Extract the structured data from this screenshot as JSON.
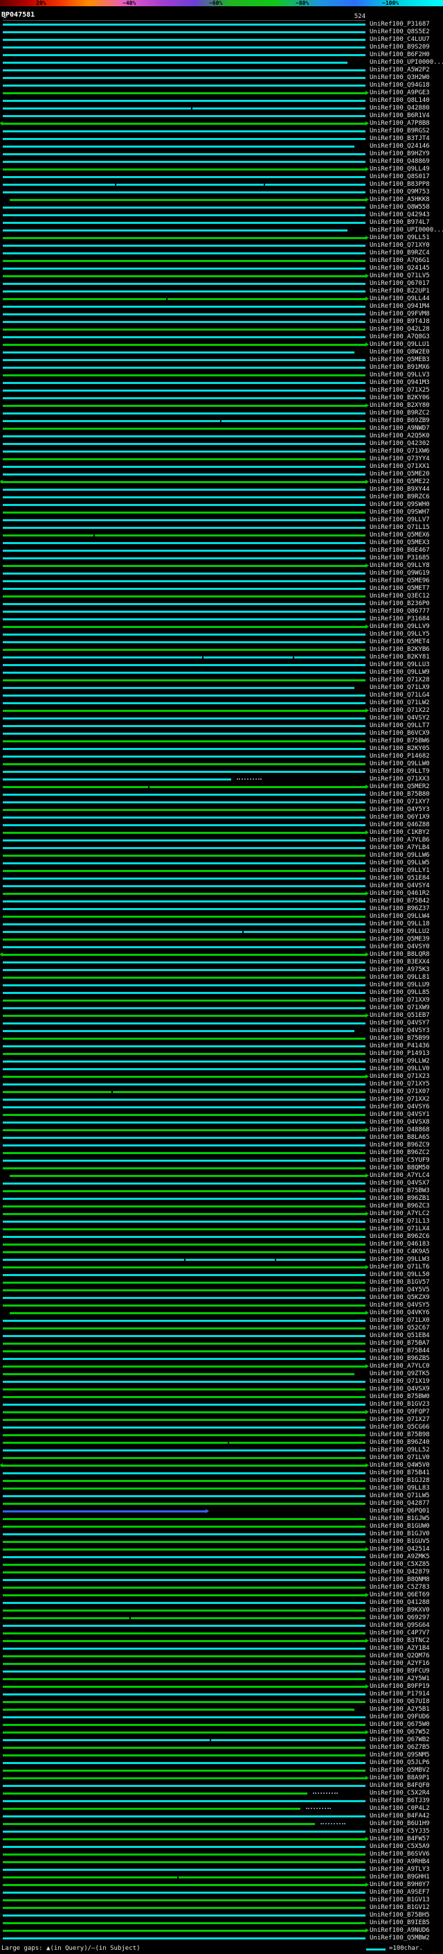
{
  "header": {
    "query_id": "BP047581"
  },
  "ruler": {
    "start": "1",
    "end": "524"
  },
  "legend": {
    "gaps_text": "Large gaps: ▲(in Query)/—(in Subject)",
    "scale_text": "=100char."
  },
  "id_prefix": "UniRef100_",
  "colors": {
    "c": "#00dcdc",
    "g": "#00cc00",
    "b": "#3264ff"
  },
  "scale": {
    "labels": [
      "20%",
      "~40%",
      "~60%",
      "~80%",
      "~100%"
    ],
    "gradient": [
      "#600000 0%",
      "#b40000 6%",
      "#f23000 13%",
      "#ff8c00 20%",
      "#e85fc0 28%",
      "#a83fd0 36%",
      "#6a3fd8 44%",
      "#20b420 52%",
      "#10c818 62%",
      "#1e96dc 72%",
      "#2d6eff 80%",
      "#00c8dc 88%",
      "#00ffff 100%"
    ]
  },
  "chart_data": {
    "type": "bar",
    "orientation": "horizontal",
    "title": "BP047581",
    "x_range": [
      1,
      524
    ],
    "x_units": "query residues (1 px = 1 char)",
    "legend_position": "top",
    "identity_color_key": {
      "~20%": "#ff8c00",
      "~40%": "#a83fd0",
      "~60%": "#20b420",
      "~80%": "#2d6eff",
      "~100%": "#00ffff"
    },
    "rows": [
      {
        "id": "P31687",
        "c": "c"
      },
      {
        "id": "Q8S5E2",
        "c": "c"
      },
      {
        "id": "C4LUU7",
        "c": "c"
      },
      {
        "id": "B9S209",
        "c": "c"
      },
      {
        "id": "B6F2H0",
        "c": "c"
      },
      {
        "id": "UPI0000...",
        "c": "c",
        "w": 0.95
      },
      {
        "id": "A5W2P2",
        "c": "c"
      },
      {
        "id": "Q3H2W0",
        "c": "c"
      },
      {
        "id": "Q94G18",
        "c": "c"
      },
      {
        "id": "A9PGE3",
        "c": "g",
        "a": 1
      },
      {
        "id": "Q8L140",
        "c": "c"
      },
      {
        "id": "Q42880",
        "c": "c",
        "G": [
          0.52
        ]
      },
      {
        "id": "B6R1V4",
        "c": "c"
      },
      {
        "id": "A7P8B8",
        "c": "g",
        "a": 1,
        "la": 1
      },
      {
        "id": "B9RGS2",
        "c": "c"
      },
      {
        "id": "B3TJT4",
        "c": "c"
      },
      {
        "id": "Q24146",
        "c": "c",
        "w": 0.97
      },
      {
        "id": "B9HZY9",
        "c": "c"
      },
      {
        "id": "Q48869",
        "c": "c"
      },
      {
        "id": "Q9LL49",
        "c": "g",
        "a": 1
      },
      {
        "id": "Q8S017",
        "c": "c"
      },
      {
        "id": "B83PP8",
        "c": "c",
        "G": [
          0.31,
          0.72
        ]
      },
      {
        "id": "Q9M753",
        "c": "c"
      },
      {
        "id": "A5HKK8",
        "c": "g",
        "a": 1,
        "s": 0.02
      },
      {
        "id": "Q8W558",
        "c": "c"
      },
      {
        "id": "Q42943",
        "c": "c"
      },
      {
        "id": "B974L7",
        "c": "c"
      },
      {
        "id": "UPI0000...",
        "c": "c",
        "w": 0.95
      },
      {
        "id": "Q9LL51",
        "c": "g",
        "a": 1
      },
      {
        "id": "Q71XY0",
        "c": "c"
      },
      {
        "id": "B9RZC4",
        "c": "c"
      },
      {
        "id": "A7Q6G1",
        "c": "g"
      },
      {
        "id": "Q24145",
        "c": "c"
      },
      {
        "id": "Q71LV5",
        "c": "g",
        "a": 1
      },
      {
        "id": "Q67017",
        "c": "c"
      },
      {
        "id": "B22UP1",
        "c": "c"
      },
      {
        "id": "Q9LL44",
        "c": "g",
        "a": 1,
        "G": [
          0.45
        ]
      },
      {
        "id": "Q941M4",
        "c": "c"
      },
      {
        "id": "Q9FVM8",
        "c": "c"
      },
      {
        "id": "B9T4J8",
        "c": "c"
      },
      {
        "id": "Q42L28",
        "c": "g"
      },
      {
        "id": "A7Q8G3",
        "c": "c"
      },
      {
        "id": "Q9LLU1",
        "c": "g",
        "a": 1
      },
      {
        "id": "Q8W2E0",
        "c": "c",
        "w": 0.97
      },
      {
        "id": "Q5MEB3",
        "c": "c"
      },
      {
        "id": "B91MX6",
        "c": "c"
      },
      {
        "id": "Q9LLV3",
        "c": "g"
      },
      {
        "id": "Q941M3",
        "c": "c"
      },
      {
        "id": "Q71X25",
        "c": "c"
      },
      {
        "id": "B2KY06",
        "c": "c"
      },
      {
        "id": "B2XY80",
        "c": "g",
        "a": 1
      },
      {
        "id": "B9RZC2",
        "c": "c"
      },
      {
        "id": "B69ZB9",
        "c": "c",
        "G": [
          0.6
        ]
      },
      {
        "id": "A9NWD7",
        "c": "g"
      },
      {
        "id": "A2Q5K0",
        "c": "c"
      },
      {
        "id": "Q42302",
        "c": "c"
      },
      {
        "id": "Q71XW6",
        "c": "c"
      },
      {
        "id": "Q73YY4",
        "c": "g"
      },
      {
        "id": "Q71XX1",
        "c": "c"
      },
      {
        "id": "Q5ME20",
        "c": "c"
      },
      {
        "id": "Q5ME22",
        "c": "g",
        "a": 1,
        "la": 1
      },
      {
        "id": "B9XY44",
        "c": "c"
      },
      {
        "id": "B9RZC6",
        "c": "c"
      },
      {
        "id": "Q9SWH0",
        "c": "c"
      },
      {
        "id": "Q9SWH7",
        "c": "g"
      },
      {
        "id": "Q9LLV7",
        "c": "c"
      },
      {
        "id": "Q71L15",
        "c": "c"
      },
      {
        "id": "Q5MEX6",
        "c": "g",
        "G": [
          0.25
        ]
      },
      {
        "id": "Q5MEX3",
        "c": "c"
      },
      {
        "id": "B6E467",
        "c": "c"
      },
      {
        "id": "P31685",
        "c": "c"
      },
      {
        "id": "Q9LLY8",
        "c": "g",
        "a": 1
      },
      {
        "id": "Q9WG19",
        "c": "c"
      },
      {
        "id": "Q5ME96",
        "c": "c"
      },
      {
        "id": "Q5MET7",
        "c": "c"
      },
      {
        "id": "Q3EC12",
        "c": "g"
      },
      {
        "id": "B236P0",
        "c": "c"
      },
      {
        "id": "Q86777",
        "c": "c"
      },
      {
        "id": "P31684",
        "c": "c"
      },
      {
        "id": "Q9LLV9",
        "c": "g",
        "a": 1
      },
      {
        "id": "Q9LLY5",
        "c": "c"
      },
      {
        "id": "Q5MET4",
        "c": "c"
      },
      {
        "id": "B2KYB6",
        "c": "g"
      },
      {
        "id": "B2KY81",
        "c": "c",
        "G": [
          0.55,
          0.8
        ]
      },
      {
        "id": "Q9LLU3",
        "c": "c"
      },
      {
        "id": "Q9LLW9",
        "c": "c"
      },
      {
        "id": "Q71X28",
        "c": "g"
      },
      {
        "id": "Q71LX9",
        "c": "c",
        "w": 0.97
      },
      {
        "id": "Q71LG4",
        "c": "c"
      },
      {
        "id": "Q71LW2",
        "c": "c"
      },
      {
        "id": "Q71X22",
        "c": "g",
        "a": 1
      },
      {
        "id": "Q4VSY2",
        "c": "c"
      },
      {
        "id": "Q9LLT7",
        "c": "c"
      },
      {
        "id": "B6VCX9",
        "c": "c"
      },
      {
        "id": "B75BW6",
        "c": "g"
      },
      {
        "id": "B2KY05",
        "c": "c"
      },
      {
        "id": "P14682",
        "c": "c"
      },
      {
        "id": "Q9LLW0",
        "c": "g"
      },
      {
        "id": "Q9LLT9",
        "c": "c"
      },
      {
        "id": "Q71XX3",
        "c": "c",
        "w": 0.63,
        "d": 1
      },
      {
        "id": "Q5MER2",
        "c": "g",
        "a": 1,
        "G": [
          0.4
        ]
      },
      {
        "id": "B75B80",
        "c": "c"
      },
      {
        "id": "Q71XY7",
        "c": "c"
      },
      {
        "id": "Q4Y5Y3",
        "c": "g"
      },
      {
        "id": "Q6Y1X9",
        "c": "c"
      },
      {
        "id": "Q46Z88",
        "c": "c"
      },
      {
        "id": "C1KBY2",
        "c": "g",
        "a": 1
      },
      {
        "id": "A7YLB6",
        "c": "c"
      },
      {
        "id": "A7YLB4",
        "c": "c"
      },
      {
        "id": "Q9LLW6",
        "c": "g"
      },
      {
        "id": "Q9LLW5",
        "c": "c"
      },
      {
        "id": "Q9LLY1",
        "c": "g"
      },
      {
        "id": "Q51E84",
        "c": "c"
      },
      {
        "id": "Q4VSY4",
        "c": "c"
      },
      {
        "id": "Q461R2",
        "c": "g",
        "a": 1
      },
      {
        "id": "B75B42",
        "c": "c"
      },
      {
        "id": "B96Z37",
        "c": "c"
      },
      {
        "id": "Q9LLW4",
        "c": "g"
      },
      {
        "id": "Q9LL18",
        "c": "c"
      },
      {
        "id": "Q9LLU2",
        "c": "c",
        "G": [
          0.66
        ]
      },
      {
        "id": "Q5ME39",
        "c": "g"
      },
      {
        "id": "Q4VSY0",
        "c": "c"
      },
      {
        "id": "B8LQR8",
        "c": "g",
        "a": 1,
        "la": 1
      },
      {
        "id": "B3EXX4",
        "c": "c"
      },
      {
        "id": "A975K3",
        "c": "c"
      },
      {
        "id": "Q9LL81",
        "c": "g"
      },
      {
        "id": "Q9LLU9",
        "c": "c"
      },
      {
        "id": "Q9LL85",
        "c": "c"
      },
      {
        "id": "Q71XX9",
        "c": "g"
      },
      {
        "id": "Q71XW9",
        "c": "c"
      },
      {
        "id": "Q51EB7",
        "c": "g",
        "a": 1
      },
      {
        "id": "Q4VSY7",
        "c": "c"
      },
      {
        "id": "Q4VSY3",
        "c": "c",
        "w": 0.97
      },
      {
        "id": "B75B99",
        "c": "g"
      },
      {
        "id": "P41436",
        "c": "c"
      },
      {
        "id": "P14913",
        "c": "g"
      },
      {
        "id": "Q9LLW2",
        "c": "c"
      },
      {
        "id": "Q9LLV0",
        "c": "c"
      },
      {
        "id": "Q71X23",
        "c": "g",
        "a": 1
      },
      {
        "id": "Q71XY5",
        "c": "c"
      },
      {
        "id": "Q71X07",
        "c": "g",
        "G": [
          0.3
        ]
      },
      {
        "id": "Q71XX2",
        "c": "c"
      },
      {
        "id": "Q4VSY6",
        "c": "c"
      },
      {
        "id": "Q4VSY1",
        "c": "g"
      },
      {
        "id": "Q4VSX8",
        "c": "c"
      },
      {
        "id": "Q48868",
        "c": "g",
        "a": 1
      },
      {
        "id": "B8LA65",
        "c": "c"
      },
      {
        "id": "B96ZC9",
        "c": "c"
      },
      {
        "id": "B96ZC2",
        "c": "g"
      },
      {
        "id": "C5YUF9",
        "c": "c"
      },
      {
        "id": "B8QM50",
        "c": "g"
      },
      {
        "id": "A7YLC4",
        "c": "g",
        "a": 1,
        "s": 0.02
      },
      {
        "id": "Q4VSX7",
        "c": "c"
      },
      {
        "id": "B75BW3",
        "c": "g"
      },
      {
        "id": "B96ZB1",
        "c": "c"
      },
      {
        "id": "B96ZC3",
        "c": "g"
      },
      {
        "id": "A7YLC2",
        "c": "g",
        "a": 1
      },
      {
        "id": "Q71L13",
        "c": "c"
      },
      {
        "id": "Q71LX4",
        "c": "g"
      },
      {
        "id": "B96ZC6",
        "c": "c"
      },
      {
        "id": "Q46183",
        "c": "g"
      },
      {
        "id": "C4K9A5",
        "c": "g"
      },
      {
        "id": "Q9LLW3",
        "c": "c",
        "G": [
          0.5,
          0.75
        ]
      },
      {
        "id": "Q71LT6",
        "c": "g",
        "a": 1
      },
      {
        "id": "Q9LL50",
        "c": "c"
      },
      {
        "id": "B1GV57",
        "c": "g"
      },
      {
        "id": "Q4Y5V5",
        "c": "g"
      },
      {
        "id": "Q5KZX9",
        "c": "c"
      },
      {
        "id": "Q4VSY5",
        "c": "g"
      },
      {
        "id": "Q4VKY6",
        "c": "g",
        "a": 1,
        "s": 0.02
      },
      {
        "id": "Q71LX0",
        "c": "c"
      },
      {
        "id": "Q52C67",
        "c": "g"
      },
      {
        "id": "Q51EB4",
        "c": "c"
      },
      {
        "id": "B75BA7",
        "c": "g"
      },
      {
        "id": "B75B44",
        "c": "g"
      },
      {
        "id": "B96ZB5",
        "c": "c"
      },
      {
        "id": "A7YLC0",
        "c": "g",
        "a": 1
      },
      {
        "id": "Q9ZTK5",
        "c": "g",
        "w": 0.97
      },
      {
        "id": "Q71X19",
        "c": "c"
      },
      {
        "id": "Q4VSX9",
        "c": "g"
      },
      {
        "id": "B75BW0",
        "c": "g"
      },
      {
        "id": "B1GV23",
        "c": "c"
      },
      {
        "id": "Q9FQP7",
        "c": "g",
        "a": 1
      },
      {
        "id": "Q71X27",
        "c": "g"
      },
      {
        "id": "Q5CG66",
        "c": "c"
      },
      {
        "id": "B75B98",
        "c": "g"
      },
      {
        "id": "B96Z40",
        "c": "g",
        "G": [
          0.62
        ]
      },
      {
        "id": "Q9LL52",
        "c": "c"
      },
      {
        "id": "Q71LV0",
        "c": "g"
      },
      {
        "id": "Q4W5V0",
        "c": "g",
        "a": 1,
        "la": 1
      },
      {
        "id": "B75B41",
        "c": "c"
      },
      {
        "id": "B1GJ28",
        "c": "g"
      },
      {
        "id": "Q9LL83",
        "c": "g"
      },
      {
        "id": "Q71LW5",
        "c": "c"
      },
      {
        "id": "Q42877",
        "c": "g"
      },
      {
        "id": "Q6PQ01",
        "c": "b",
        "a": 1,
        "w": 0.56
      },
      {
        "id": "B1GJW5",
        "c": "g"
      },
      {
        "id": "B1GUW0",
        "c": "g"
      },
      {
        "id": "B1GJV0",
        "c": "c"
      },
      {
        "id": "B1GUV5",
        "c": "g"
      },
      {
        "id": "Q42514",
        "c": "g",
        "a": 1
      },
      {
        "id": "A9ZMK5",
        "c": "c"
      },
      {
        "id": "C5XZ85",
        "c": "g"
      },
      {
        "id": "Q42879",
        "c": "g"
      },
      {
        "id": "B8QNM8",
        "c": "c"
      },
      {
        "id": "C5Z783",
        "c": "g"
      },
      {
        "id": "Q6ET69",
        "c": "g",
        "a": 1
      },
      {
        "id": "Q41288",
        "c": "c"
      },
      {
        "id": "B9KXV0",
        "c": "g"
      },
      {
        "id": "Q69297",
        "c": "g",
        "G": [
          0.35
        ]
      },
      {
        "id": "Q9SG64",
        "c": "c"
      },
      {
        "id": "C4P7V7",
        "c": "g"
      },
      {
        "id": "B3TNC2",
        "c": "g",
        "a": 1
      },
      {
        "id": "A2Y1B4",
        "c": "c"
      },
      {
        "id": "Q2QM76",
        "c": "g"
      },
      {
        "id": "A2YF16",
        "c": "g"
      },
      {
        "id": "B9FCU9",
        "c": "c"
      },
      {
        "id": "A2Y5W1",
        "c": "g"
      },
      {
        "id": "B9FP19",
        "c": "g",
        "a": 1
      },
      {
        "id": "P17914",
        "c": "c"
      },
      {
        "id": "Q67UI8",
        "c": "g"
      },
      {
        "id": "A2Y5B1",
        "c": "g",
        "w": 0.97
      },
      {
        "id": "Q9FUD6",
        "c": "c"
      },
      {
        "id": "Q675W0",
        "c": "g"
      },
      {
        "id": "Q67W52",
        "c": "g",
        "a": 1
      },
      {
        "id": "Q67WB2",
        "c": "c",
        "G": [
          0.57
        ]
      },
      {
        "id": "Q6Z7B5",
        "c": "g"
      },
      {
        "id": "Q9SNM5",
        "c": "g"
      },
      {
        "id": "Q5JLP6",
        "c": "c"
      },
      {
        "id": "Q5MBV2",
        "c": "g"
      },
      {
        "id": "B8A9P1",
        "c": "g",
        "a": 1
      },
      {
        "id": "B4FQF0",
        "c": "c"
      },
      {
        "id": "C5X2R4",
        "c": "g",
        "w": 0.84,
        "d": 1
      },
      {
        "id": "B6TJ39",
        "c": "c"
      },
      {
        "id": "C0P4L2",
        "c": "g",
        "w": 0.82,
        "d": 1
      },
      {
        "id": "B4FA42",
        "c": "c"
      },
      {
        "id": "B6U1H9",
        "c": "g",
        "w": 0.86,
        "d": 1
      },
      {
        "id": "C5YJ35",
        "c": "c"
      },
      {
        "id": "B4FW57",
        "c": "g",
        "a": 1
      },
      {
        "id": "C5X5A9",
        "c": "c"
      },
      {
        "id": "B6SVV6",
        "c": "g"
      },
      {
        "id": "A9RHB4",
        "c": "g"
      },
      {
        "id": "A9TLY3",
        "c": "c"
      },
      {
        "id": "B9GHH1",
        "c": "g",
        "G": [
          0.48
        ]
      },
      {
        "id": "B9H0Y7",
        "c": "g",
        "a": 1
      },
      {
        "id": "A9SEF7",
        "c": "c"
      },
      {
        "id": "B1GV13",
        "c": "g"
      },
      {
        "id": "B1GV12",
        "c": "g"
      },
      {
        "id": "B75BH5",
        "c": "c"
      },
      {
        "id": "B9IEB5",
        "c": "g"
      },
      {
        "id": "A9NUD6",
        "c": "g",
        "a": 1
      },
      {
        "id": "Q5MBW2",
        "c": "c"
      }
    ]
  }
}
